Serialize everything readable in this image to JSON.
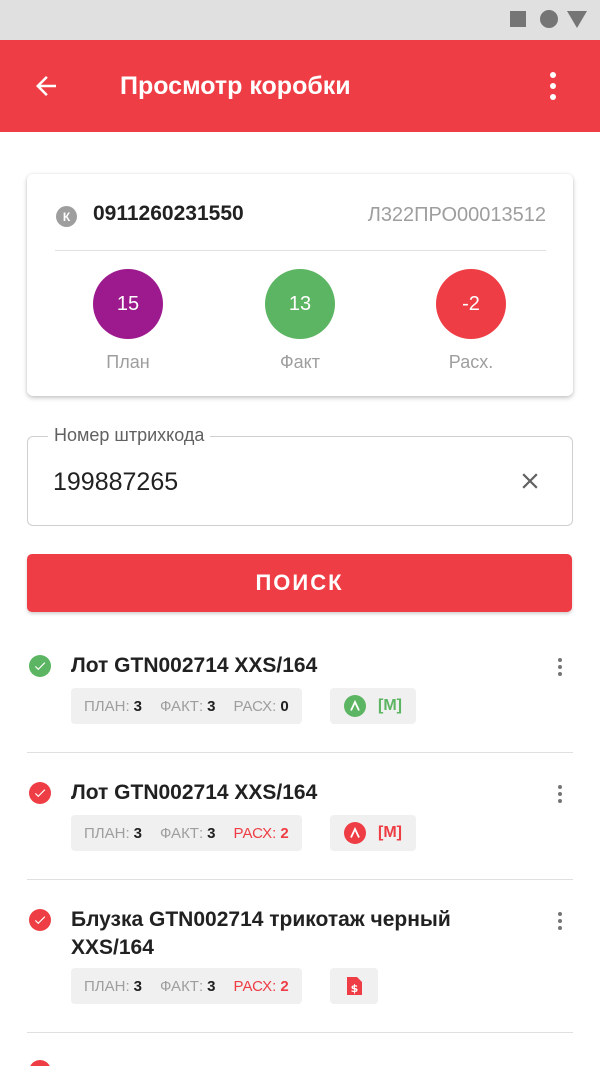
{
  "app_bar": {
    "title": "Просмотр коробки"
  },
  "box": {
    "badge": "К",
    "code": "0911260231550",
    "ref": "Л322ПРО00013512",
    "stats": [
      {
        "value": "15",
        "label": "План",
        "color": "#9c1a8d"
      },
      {
        "value": "13",
        "label": "Факт",
        "color": "#5cb562"
      },
      {
        "value": "-2",
        "label": "Расх.",
        "color": "#ee3d44"
      }
    ]
  },
  "search": {
    "label": "Номер штрихкода",
    "value": "199887265",
    "button": "ПОИСК"
  },
  "items": [
    {
      "title": "Лот GTN002714 XXS/164",
      "status": "ok",
      "plan_label": "ПЛАН:",
      "plan": "3",
      "fact_label": "ФАКТ:",
      "fact": "3",
      "diff_label": "РАСХ:",
      "diff": "0",
      "tag_letter": "Λ",
      "tag_text": "[M]",
      "tag_color": "#5cb562"
    },
    {
      "title": "Лот GTN002714 XXS/164",
      "status": "error",
      "plan_label": "ПЛАН:",
      "plan": "3",
      "fact_label": "ФАКТ:",
      "fact": "3",
      "diff_label": "РАСХ:",
      "diff": "2",
      "tag_letter": "Λ",
      "tag_text": "[M]",
      "tag_color": "#ee3d44"
    },
    {
      "title": "Блузка GTN002714 трикотаж черный XXS/164",
      "status": "error",
      "plan_label": "ПЛАН:",
      "plan": "3",
      "fact_label": "ФАКТ:",
      "fact": "3",
      "diff_label": "РАСХ:",
      "diff": "2",
      "tag_icon": "price-tag-icon",
      "tag_color": "#ee3d44"
    }
  ],
  "colors": {
    "accent": "#ee3d44",
    "ok": "#5cb562",
    "plan": "#9c1a8d"
  }
}
